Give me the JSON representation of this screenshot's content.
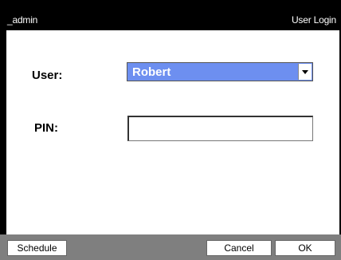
{
  "titlebar": {
    "left_text": "_admin",
    "right_text": "User Login"
  },
  "form": {
    "user_label": "User:",
    "user_value": "Robert",
    "pin_label": "PIN:",
    "pin_value": ""
  },
  "buttons": {
    "schedule": "Schedule",
    "cancel": "Cancel",
    "ok": "OK"
  },
  "colors": {
    "select_highlight": "#6d8ff0",
    "bottom_bar": "#7f7f7f",
    "title_bar": "#000000"
  }
}
